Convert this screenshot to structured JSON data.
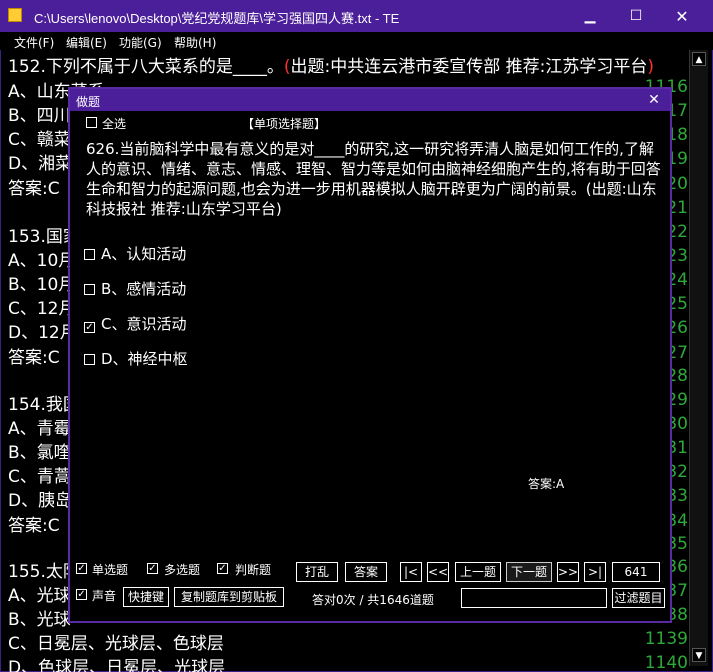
{
  "window": {
    "title": "C:\\Users\\lenovo\\Desktop\\党纪党规题库\\学习强国四人赛.txt - TE",
    "min": "▁",
    "max": "☐",
    "close": "✕"
  },
  "menu": [
    "文件(F)",
    "编辑(E)",
    "功能(G)",
    "帮助(H)"
  ],
  "background": {
    "q152": {
      "pre": "152.下列不属于八大菜系的是____。",
      "paren_open": "(",
      "source": "出题:中共连云港市委宣传部  推荐:江苏学习平台",
      "paren_close": ")"
    },
    "lines": [
      "A、山东菜系",
      "B、四川",
      "C、赣菜",
      "D、湘菜",
      "答案:C",
      "153.国家",
      "A、10月",
      "B、10月",
      "C、12月",
      "D、12月",
      "答案:C",
      "154.我国",
      "A、青霉",
      "B、氯喹",
      "C、青蒿",
      "D、胰岛",
      "答案:C",
      "155.太阳",
      "A、光球",
      "B、光球",
      "C、日冕层、光球层、色球层",
      "D、色球层、日冕层、光球层"
    ],
    "nums": [
      "1116",
      "1117",
      "1118",
      "1119",
      "1120",
      "1121",
      "1122",
      "1123",
      "1124",
      "1125",
      "1126",
      "1127",
      "1128",
      "1129",
      "1130",
      "1131",
      "1132",
      "1133",
      "1134",
      "1135",
      "1136",
      "1137",
      "1138",
      "1139",
      "1140"
    ]
  },
  "dialog": {
    "title": "做题",
    "close": "✕",
    "select_all": "全选",
    "type_label": "【单项选择题】",
    "question": "626.当前脑科学中最有意义的是对____的研究,这一研究将弄清人脑是如何工作的,了解人的意识、情绪、意志、情感、理智、智力等是如何由脑神经细胞产生的,将有助于回答生命和智力的起源问题,也会为进一步用机器模拟人脑开辟更为广阔的前景。(出题:山东科技报社  推荐:山东学习平台)",
    "options": [
      {
        "label": "A、认知活动",
        "checked": false
      },
      {
        "label": "B、感情活动",
        "checked": false
      },
      {
        "label": "C、意识活动",
        "checked": true
      },
      {
        "label": "D、神经中枢",
        "checked": false
      }
    ],
    "answer": "答案:A",
    "filters": {
      "single": "单选题",
      "multi": "多选题",
      "judge": "判断题",
      "sound": "声音"
    },
    "buttons": {
      "shuffle": "打乱",
      "answer": "答案",
      "first": "|<",
      "prev_fast": "<<",
      "prev": "上一题",
      "next": "下一题",
      "next_fast": ">>",
      "last": ">|",
      "shortcut": "快捷键",
      "copy": "复制题库到剪贴板",
      "filter": "过滤题目"
    },
    "page_number": "641",
    "stats": "答对0次 / 共1646道题",
    "filter_input": ""
  }
}
